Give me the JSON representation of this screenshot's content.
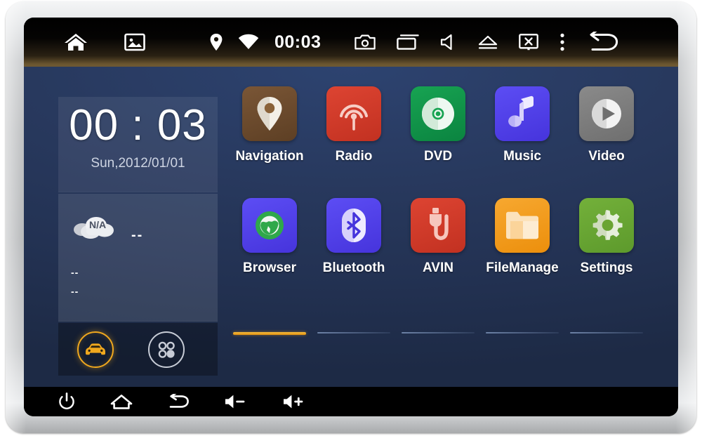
{
  "device": {
    "type": "car-head-unit",
    "bezel_color": "#b9bbbd",
    "screen_background": "#233253"
  },
  "statusbar": {
    "background": "#000000",
    "clock": "00:03",
    "left_icons": [
      {
        "name": "home-icon",
        "glyph": "home"
      },
      {
        "name": "gallery-icon",
        "glyph": "picture"
      }
    ],
    "mid_icons": [
      {
        "name": "location-icon",
        "glyph": "pin"
      },
      {
        "name": "wifi-icon",
        "glyph": "wifi"
      }
    ],
    "right_icons": [
      {
        "name": "screenshot-icon",
        "glyph": "camera"
      },
      {
        "name": "recents-icon",
        "glyph": "window"
      },
      {
        "name": "mute-icon",
        "glyph": "speaker"
      },
      {
        "name": "eject-icon",
        "glyph": "eject"
      },
      {
        "name": "screen-off-icon",
        "glyph": "monitor-x"
      },
      {
        "name": "overflow-menu-icon",
        "glyph": "dots-vertical"
      },
      {
        "name": "back-icon",
        "glyph": "back-arrow"
      }
    ]
  },
  "widgets": {
    "clock": {
      "time": "00 : 03",
      "date": "Sun,2012/01/01"
    },
    "weather": {
      "condition": "N/A",
      "temperature": "--",
      "line1": "--",
      "line2": "--"
    },
    "shortcuts": [
      {
        "name": "car-mode-button",
        "icon": "car-icon",
        "color": "#f0a81e",
        "active": true
      },
      {
        "name": "all-apps-button",
        "icon": "apps-dots-icon",
        "color": "#c7ccd6",
        "active": false
      }
    ]
  },
  "apps": [
    {
      "label": "Navigation",
      "icon": "map-pin-icon",
      "bg": "#6d4b2e",
      "fg": "#f2ece3"
    },
    {
      "label": "Radio",
      "icon": "broadcast-icon",
      "bg": "#d2382a",
      "fg": "#f9cfc9"
    },
    {
      "label": "DVD",
      "icon": "disc-icon",
      "bg": "#109247",
      "fg": "#d9f2e2"
    },
    {
      "label": "Music",
      "icon": "music-note-icon",
      "bg": "#5043e8",
      "fg": "#ddd9fb"
    },
    {
      "label": "Video",
      "icon": "play-circle-icon",
      "bg": "#7c7c7c",
      "fg": "#efefef"
    },
    {
      "label": "Browser",
      "icon": "globe-icon",
      "bg": "#5043e8",
      "fg": "#2fa84a"
    },
    {
      "label": "Bluetooth",
      "icon": "bluetooth-icon",
      "bg": "#5043e8",
      "fg": "#ddd9fb"
    },
    {
      "label": "AVIN",
      "icon": "avin-plug-icon",
      "bg": "#d2382a",
      "fg": "#f6c6bd"
    },
    {
      "label": "FileManage",
      "icon": "folder-icon",
      "bg": "#f09a1a",
      "fg": "#fde2bb"
    },
    {
      "label": "Settings",
      "icon": "gear-icon",
      "bg": "#67a433",
      "fg": "#e3efd7"
    }
  ],
  "pager": {
    "pages": 5,
    "active_index": 0,
    "active_color": "#e8a31c",
    "inactive_color": "#8fa6cc"
  },
  "navbar": {
    "background": "#000000",
    "buttons": [
      {
        "name": "power-button",
        "icon": "power-icon"
      },
      {
        "name": "home-button",
        "icon": "home-icon"
      },
      {
        "name": "back-button",
        "icon": "back-arrow-icon"
      },
      {
        "name": "volume-down-button",
        "icon": "volume-minus-icon"
      },
      {
        "name": "volume-up-button",
        "icon": "volume-plus-icon"
      }
    ]
  }
}
